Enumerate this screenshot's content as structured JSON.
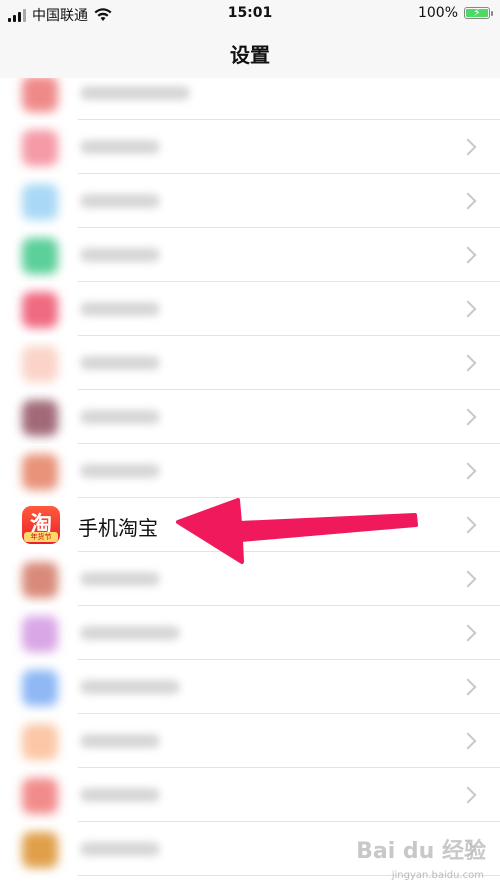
{
  "status_bar": {
    "carrier": "中国联通",
    "time": "15:01",
    "battery_percent": "100%"
  },
  "nav": {
    "title": "设置"
  },
  "focus_item": {
    "label": "手机淘宝",
    "icon_glyph": "淘",
    "icon_tag": "年货节"
  },
  "watermark": {
    "text": "Bai du 经验",
    "sub": "jingyan.baidu.com"
  },
  "colors": {
    "arrow": "#f0195c",
    "taobao_red": "#e8202a"
  }
}
